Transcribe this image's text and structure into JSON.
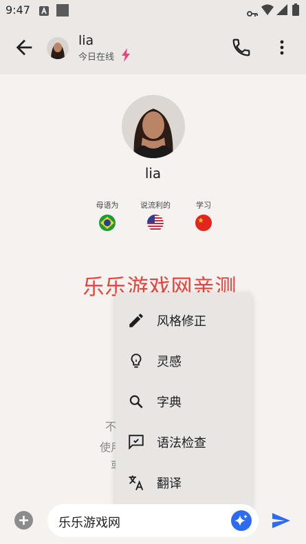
{
  "status_bar": {
    "time": "9:47"
  },
  "header": {
    "contact_name": "lia",
    "online_status": "今日在线",
    "accent_color": "#e8457f"
  },
  "profile": {
    "name": "lia",
    "languages": [
      {
        "label": "母语为",
        "flag": "brazil-flag"
      },
      {
        "label": "说流利的",
        "flag": "usa-flag"
      },
      {
        "label": "学习",
        "flag": "china-flag"
      }
    ]
  },
  "watermark": "乐乐游戏网亲测",
  "partially_hidden_text": [
    "不",
    "使用",
    "或"
  ],
  "context_menu": {
    "items": [
      {
        "label": "风格修正",
        "icon": "pencil-icon"
      },
      {
        "label": "灵感",
        "icon": "lightbulb-icon"
      },
      {
        "label": "字典",
        "icon": "search-icon"
      },
      {
        "label": "语法检查",
        "icon": "grammar-check-icon"
      },
      {
        "label": "翻译",
        "icon": "translate-icon"
      }
    ]
  },
  "composer": {
    "value": "乐乐游戏网",
    "ai_button_color": "#2d6bf0",
    "send_color": "#2d6bf0"
  }
}
